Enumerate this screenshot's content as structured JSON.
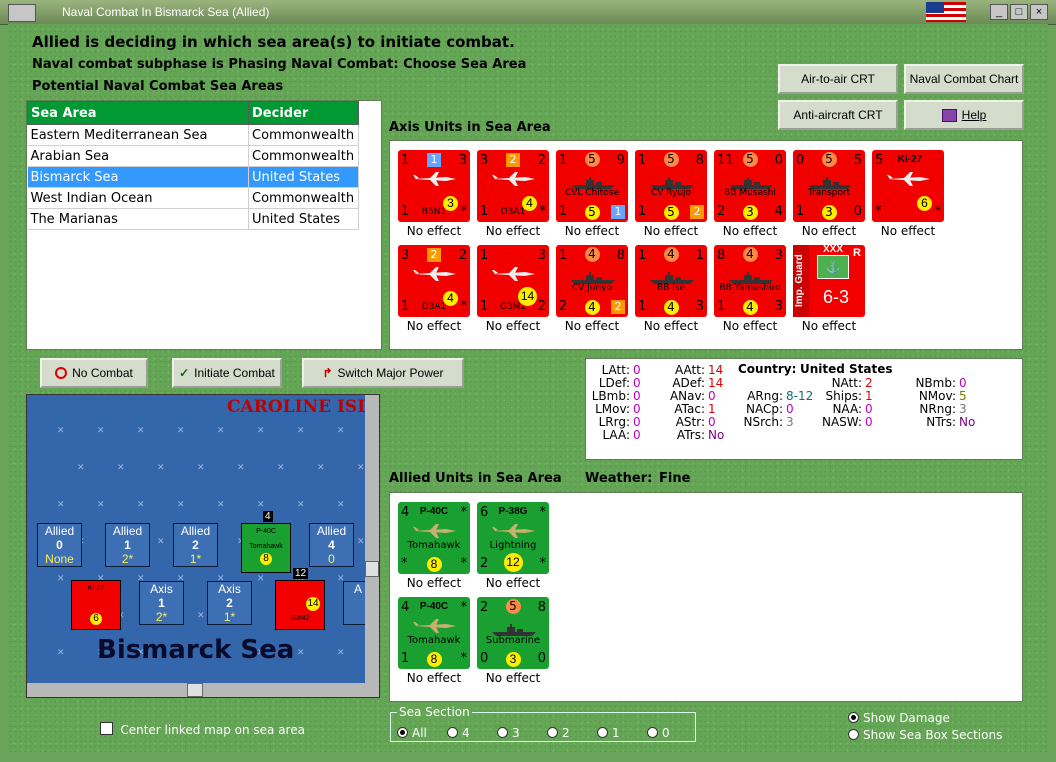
{
  "window": {
    "title": "Naval Combat In Bismarck Sea (Allied)",
    "btn_min": "_",
    "btn_max": "□",
    "btn_close": "×"
  },
  "header": {
    "line1": "Allied is deciding in which sea area(s) to initiate combat.",
    "line2": "Naval combat subphase is Phasing Naval Combat: Choose Sea Area",
    "line3": "Potential Naval Combat Sea Areas"
  },
  "buttons": {
    "air_to_air": "Air-to-air CRT",
    "naval_chart": "Naval Combat Chart",
    "anti_aircraft": "Anti-aircraft CRT",
    "help": "Help",
    "no_combat": "No Combat",
    "initiate": "Initiate Combat",
    "switch": "Switch Major Power"
  },
  "sea_table": {
    "headers": [
      "Sea Area",
      "Decider"
    ],
    "rows": [
      [
        "Eastern Mediterranean Sea",
        "Commonwealth"
      ],
      [
        "Arabian Sea",
        "Commonwealth"
      ],
      [
        "Bismarck Sea",
        "United States"
      ],
      [
        "West Indian Ocean",
        "Commonwealth"
      ],
      [
        "The Marianas",
        "United States"
      ]
    ]
  },
  "axis_title": "Axis Units in Sea Area",
  "allied_title": "Allied Units in Sea Area",
  "weather": {
    "label": "Weather:",
    "value": "Fine"
  },
  "effect_text": "No effect",
  "axis_units": [
    {
      "tl": "1",
      "tc": "1",
      "tr": "3",
      "tok": "3",
      "bl": "1",
      "name": "B5N1",
      "br": "*"
    },
    {
      "tl": "3",
      "tc": "2",
      "tr": "2",
      "tok": "4",
      "bl": "1",
      "name": "D3A1",
      "br": "*"
    },
    {
      "tl": "1",
      "tc": "5",
      "tr": "9",
      "name": "CVL Chitose",
      "bl": "1",
      "bc": "5",
      "br": "1"
    },
    {
      "tl": "1",
      "tc": "5",
      "tr": "8",
      "name": "CV Ryujo",
      "bl": "1",
      "bc": "5",
      "br": "2"
    },
    {
      "tl": "11",
      "tc": "5",
      "tr": "0",
      "name": "BB Musashi",
      "bl": "2",
      "bc": "3",
      "br": "4"
    },
    {
      "tl": "0",
      "tc": "5",
      "tr": "5",
      "name": "Transport",
      "bl": "1",
      "bc": "3",
      "br": "0"
    },
    {
      "tl": "5",
      "name": "Ki-27",
      "tok": "6",
      "bl": "*",
      "br": "*"
    },
    {
      "tl": "3",
      "tc": "2",
      "tr": "2",
      "tok": "4",
      "bl": "1",
      "name": "D3A1",
      "br": "*"
    },
    {
      "tl": "1",
      "tr": "3",
      "tok": "14",
      "bl": "1",
      "name": "G3M2",
      "br": "2"
    },
    {
      "tl": "1",
      "tc": "4",
      "tr": "8",
      "name": "CV Junyo",
      "bl": "2",
      "bc": "4",
      "br": "2"
    },
    {
      "tl": "1",
      "tc": "4",
      "tr": "1",
      "name": "BB Ise",
      "bl": "1",
      "bc": "4",
      "br": "3"
    },
    {
      "tl": "8",
      "tc": "4",
      "tr": "3",
      "name": "BB Yamashiro",
      "bl": "1",
      "bc": "4",
      "br": "3"
    },
    {
      "side": "Imp. Guard",
      "corps": "XXX",
      "tag": "R",
      "str": "6-3"
    }
  ],
  "allied_units": [
    {
      "tl": "4",
      "name": "P-40C",
      "tr": "*",
      "sub": "Tomahawk",
      "bl": "*",
      "tok": "8",
      "br": "*"
    },
    {
      "tl": "6",
      "name": "P-38G",
      "tr": "*",
      "sub": "Lightning",
      "bl": "2",
      "tok": "12",
      "br": "*"
    },
    {
      "tl": "4",
      "name": "P-40C",
      "tr": "*",
      "sub": "Tomahawk",
      "bl": "1",
      "tok": "8",
      "br": "*"
    },
    {
      "tl": "2",
      "tc": "5",
      "tr": "8",
      "sub": "Submarine",
      "bl": "0",
      "tok": "3",
      "br": "0"
    }
  ],
  "stats": {
    "country_label": "Country:",
    "country": "United States",
    "col1": [
      [
        "LAtt:",
        "0"
      ],
      [
        "LDef:",
        "0"
      ],
      [
        "LBmb:",
        "0"
      ],
      [
        "LMov:",
        "0"
      ],
      [
        "LRrg:",
        "0"
      ],
      [
        "LAA:",
        "0"
      ]
    ],
    "col2": [
      [
        "AAtt:",
        "14"
      ],
      [
        "ADef:",
        "14"
      ],
      [
        "ANav:",
        "0"
      ],
      [
        "ATac:",
        "1"
      ],
      [
        "AStr:",
        "0"
      ],
      [
        "ATrs:",
        "No"
      ]
    ],
    "col3": [
      [
        "ARng:",
        "8-12"
      ],
      [
        "NACp:",
        "0"
      ],
      [
        "NSrch:",
        "3"
      ]
    ],
    "col4": [
      [
        "NAtt:",
        "2"
      ],
      [
        "Ships:",
        "1"
      ],
      [
        "NAA:",
        "0"
      ],
      [
        "NASW:",
        "0"
      ]
    ],
    "col5": [
      [
        "NBmb:",
        "0"
      ],
      [
        "NMov:",
        "5"
      ],
      [
        "NRng:",
        "3"
      ],
      [
        "NTrs:",
        "No"
      ]
    ]
  },
  "map": {
    "region": "CAROLINE ISL",
    "sea": "Bismarck Sea",
    "allied_boxes": [
      [
        "Allied",
        "0",
        "None"
      ],
      [
        "Allied",
        "1",
        "2*"
      ],
      [
        "Allied",
        "2",
        "1*"
      ],
      [
        "Allied",
        "4",
        "0"
      ]
    ],
    "axis_boxes": [
      [
        "Axis",
        "1",
        "2*"
      ],
      [
        "Axis",
        "2",
        "1*"
      ]
    ],
    "axis_box_partial": "A",
    "stack1": "4",
    "stack2": "12",
    "tok1": "8",
    "tok2": "6",
    "tok3": "14",
    "u1_name": "P-40C",
    "u1_sub": "Tomahawk",
    "u2_name": "Ki-27",
    "u3_name": "G3M2"
  },
  "center_map_label": "Center linked map on sea area",
  "sea_section": {
    "label": "Sea Section",
    "options": [
      "All",
      "4",
      "3",
      "2",
      "1",
      "0"
    ]
  },
  "show_damage": "Show Damage",
  "show_sections": "Show Sea Box Sections",
  "colors": {
    "red_unit": "#f20000",
    "green_unit": "#1aa030",
    "selected_row": "#3399ff",
    "header_green": "#009933"
  }
}
